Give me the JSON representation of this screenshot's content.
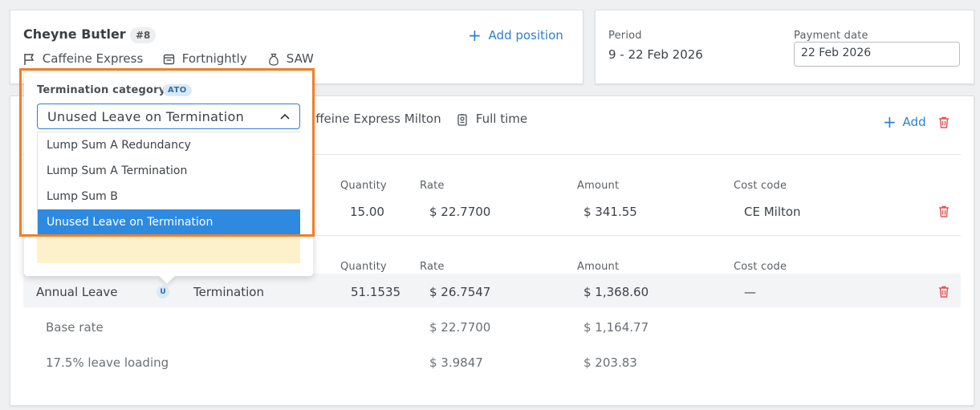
{
  "employee": {
    "name": "Cheyne Butler",
    "number_badge": "#8",
    "company": "Caffeine Express",
    "pay_frequency": "Fortnightly",
    "award": "SAW",
    "add_position_label": "Add position"
  },
  "period": {
    "period_label": "Period",
    "period_value": "9 - 22 Feb 2026",
    "payment_date_label": "Payment date",
    "payment_date_value": "22 Feb 2026"
  },
  "position": {
    "location": "affeine Express Milton",
    "employment_type": "Full time",
    "add_label": "Add"
  },
  "table_headers": {
    "quantity": "Quantity",
    "rate": "Rate",
    "amount": "Amount",
    "cost_code": "Cost code"
  },
  "earnings_row": {
    "quantity": "15.00",
    "rate": "$ 22.7700",
    "amount": "$ 341.55",
    "cost_code": "CE Milton"
  },
  "leave_row": {
    "name": "Annual Leave",
    "badge": "U",
    "type": "Termination",
    "quantity": "51.1535",
    "rate": "$ 26.7547",
    "amount": "$ 1,368.60",
    "cost_code": "—"
  },
  "sub_rows": [
    {
      "label": "Base rate",
      "rate": "$ 22.7700",
      "amount": "$ 1,164.77"
    },
    {
      "label": "17.5% leave loading",
      "rate": "$ 3.9847",
      "amount": "$ 203.83"
    }
  ],
  "termination_popup": {
    "label": "Termination category",
    "badge": "ATO",
    "selected_value": "Unused Leave on Termination",
    "options": [
      "Lump Sum A Redundancy",
      "Lump Sum A Termination",
      "Lump Sum B",
      "Unused Leave on Termination"
    ]
  },
  "colors": {
    "accent": "#2d7fcf",
    "highlight_outline": "#ef7f26",
    "selected_option": "#2d8ae0",
    "delete_red": "#e25555",
    "warning_strip": "#fdf1cc"
  }
}
